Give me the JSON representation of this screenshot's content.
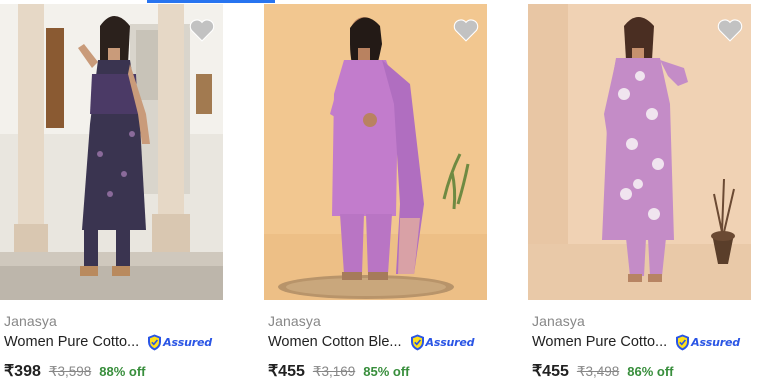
{
  "products": [
    {
      "brand": "Janasya",
      "title": "Women Pure Cotto...",
      "assured_label": "Assured",
      "price": "₹398",
      "mrp": "₹3,598",
      "discount": "88% off",
      "image_icon": "product-photo-navy-floral-dress",
      "wishlist_icon": "heart-icon"
    },
    {
      "brand": "Janasya",
      "title": "Women Cotton Ble...",
      "assured_label": "Assured",
      "price": "₹455",
      "mrp": "₹3,169",
      "discount": "85% off",
      "image_icon": "product-photo-lavender-kurta-set",
      "wishlist_icon": "heart-icon"
    },
    {
      "brand": "Janasya",
      "title": "Women Pure Cotto...",
      "assured_label": "Assured",
      "price": "₹455",
      "mrp": "₹3,498",
      "discount": "86% off",
      "image_icon": "product-photo-purple-print-kurta-set",
      "wishlist_icon": "heart-icon"
    }
  ],
  "colors": {
    "brand_text": "#878787",
    "title_text": "#212121",
    "discount": "#388e3c",
    "assured_blue": "#2a55e5",
    "accent_tab": "#2874f0"
  }
}
